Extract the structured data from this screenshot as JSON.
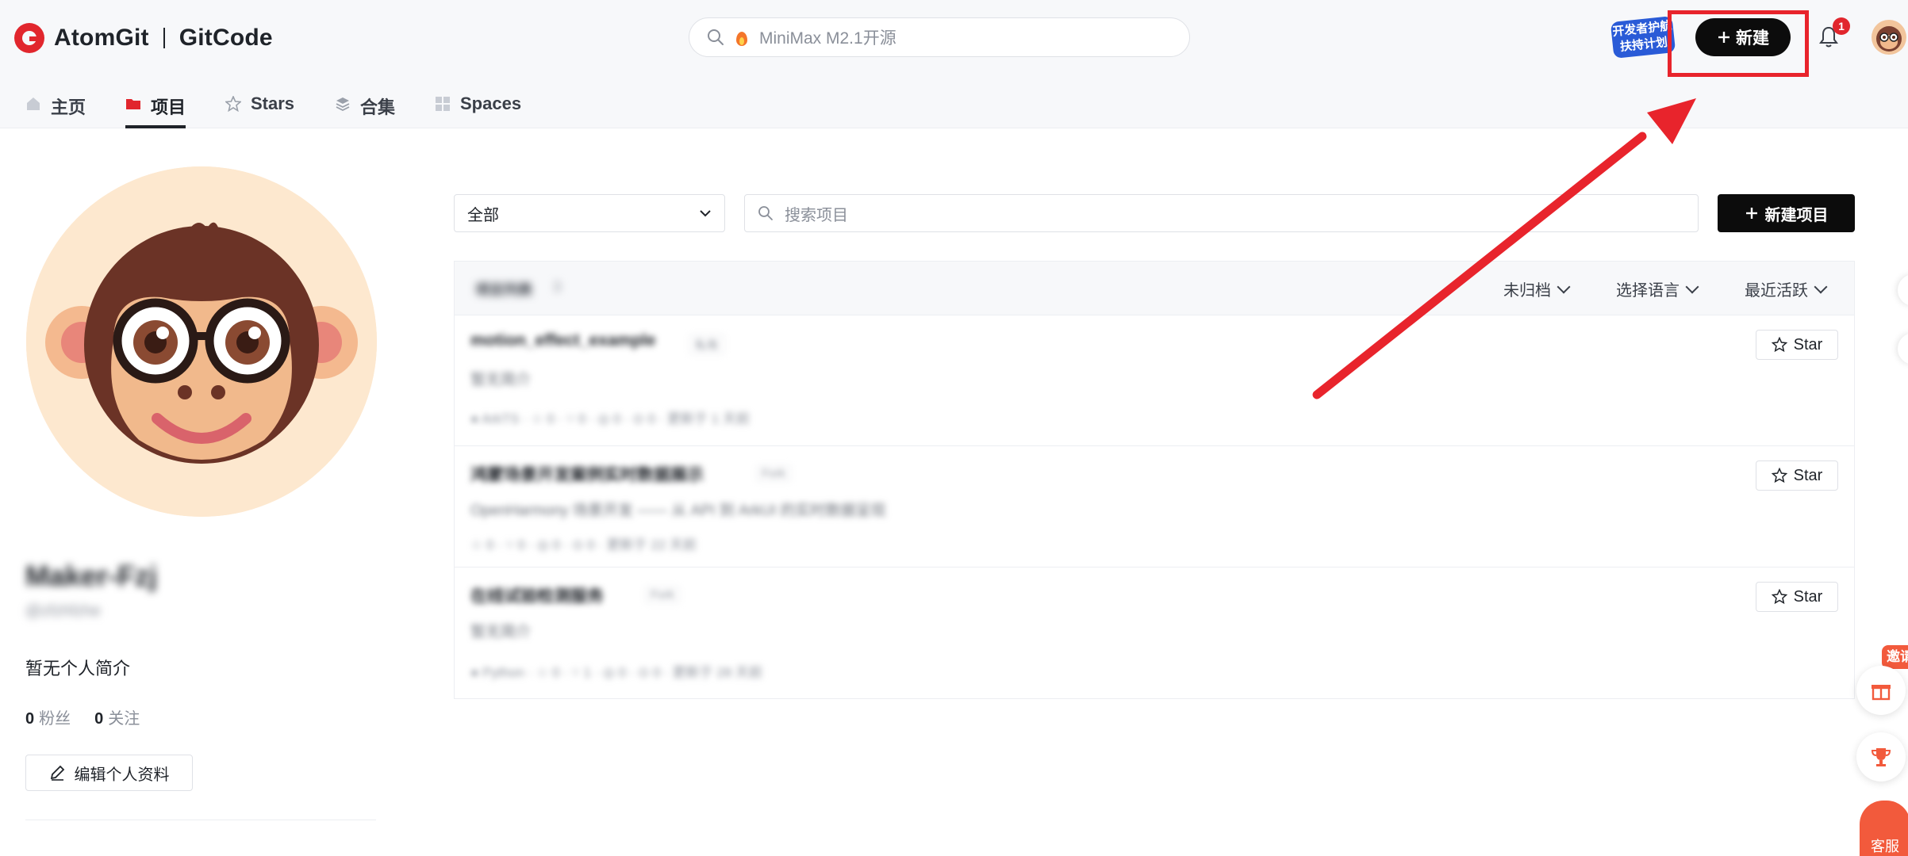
{
  "header": {
    "brand": "AtomGit",
    "brand2": "GitCode",
    "search_placeholder": "MiniMax M2.1开源",
    "promo_text": "开发者护航扶持计划",
    "new_button": "新建",
    "notification_count": "1"
  },
  "tabs": [
    {
      "label": "主页",
      "icon": "home-icon"
    },
    {
      "label": "项目",
      "icon": "folder-icon",
      "active": true
    },
    {
      "label": "Stars",
      "icon": "star-icon"
    },
    {
      "label": "合集",
      "icon": "layers-icon"
    },
    {
      "label": "Spaces",
      "icon": "grid-icon"
    }
  ],
  "profile": {
    "username": "Maker-Fzj",
    "handle": "@zfzhfzhe",
    "bio": "暂无个人简介",
    "followers_count": "0",
    "followers_label": "粉丝",
    "following_count": "0",
    "following_label": "关注",
    "edit_button": "编辑个人资料"
  },
  "toolbar": {
    "filter_value": "全部",
    "search_placeholder": "搜索项目",
    "new_project_button": "新建项目"
  },
  "list": {
    "header_title": "项目列表",
    "header_count": "3",
    "sort_archived": "未归档",
    "sort_language": "选择语言",
    "sort_recent": "最近活跃",
    "rows": [
      {
        "name": "motion_effect_example",
        "tag": "私有",
        "desc": "暂无简介",
        "meta": "● ArkTS · ☆ 0 · ⑂ 0 · ◎ 0 · ⊙ 0 · 更新于 1 天前",
        "star": "Star"
      },
      {
        "name": "鸿蒙场景开发案例实时数据展示",
        "tag": "Fork",
        "desc": "OpenHarmony 场景开发 —— 从 API 到 ArkUI 的实时数据呈现",
        "meta": "☆ 0 · ⑂ 0 · ◎ 0 · ⊙ 0 · 更新于 22 天前",
        "star": "Star"
      },
      {
        "name": "在线试验检测服务",
        "tag": "Fork",
        "desc": "暂无简介",
        "meta": "● Python · ☆ 0 · ⑂ 1 · ◎ 0 · ⊙ 0 · 更新于 28 天前",
        "star": "Star"
      }
    ]
  },
  "floating": {
    "invite": "邀请",
    "service": "客服"
  },
  "colors": {
    "brand_red": "#e1262d",
    "annotation_red": "#e8242c",
    "primary_black": "#0c0c0c"
  }
}
